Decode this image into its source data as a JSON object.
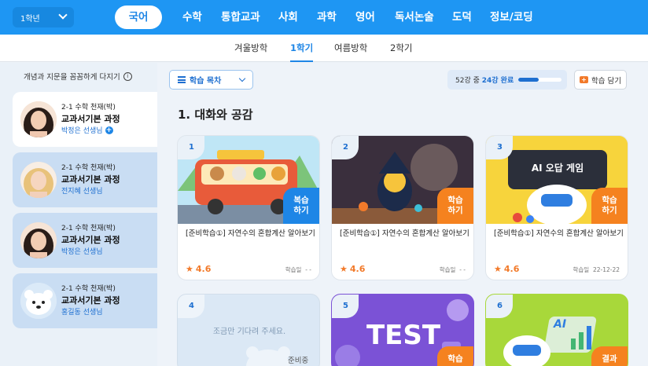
{
  "header": {
    "grade": "1학년",
    "subjects": [
      "국어",
      "수학",
      "통합교과",
      "사회",
      "과학",
      "영어",
      "독서논술",
      "도덕",
      "정보/코딩"
    ],
    "active_subject": "국어"
  },
  "semesters": [
    "겨울방학",
    "1학기",
    "여름방학",
    "2학기"
  ],
  "sidebar": {
    "hint": "개념과 지문을 꼼꼼하게 다지기",
    "teachers": [
      {
        "line1": "2-1 수학 천재(박)",
        "line2": "교과서기본 과정",
        "line3": "박정은 선생님"
      },
      {
        "line1": "2-1 수학 천재(박)",
        "line2": "교과서기본 과정",
        "line3": "전지혜 선생님"
      },
      {
        "line1": "2-1 수학 천재(박)",
        "line2": "교과서기본 과정",
        "line3": "박정은 선생님"
      },
      {
        "line1": "2-1 수학 천재(박)",
        "line2": "교과서기본 과정",
        "line3": "홍길동 선생님"
      }
    ]
  },
  "toolbar": {
    "toc_label": "학습 목차",
    "progress_prefix": "52강 중 ",
    "progress_done": "24강 완료",
    "progress_fraction": 0.46,
    "save_label": "학습 담기"
  },
  "section": {
    "title": "1. 대화와 공감"
  },
  "cards": [
    {
      "num": "1",
      "title": "[준비학습①] 자연수의 혼합계산 알아보기",
      "rating": "4.6",
      "date_label": "학습일",
      "date_value": "- -",
      "badge_l1": "복습",
      "badge_l2": "하기",
      "badge_color": "blue"
    },
    {
      "num": "2",
      "title": "[준비학습①] 자연수의 혼합계산 알아보기",
      "rating": "4.6",
      "date_label": "학습일",
      "date_value": "- -",
      "badge_l1": "학습",
      "badge_l2": "하기",
      "badge_color": "orange"
    },
    {
      "num": "3",
      "title": "[준비학습①] 자연수의 혼합계산 알아보기",
      "rating": "4.6",
      "date_label": "학습일",
      "date_value": "22-12-22",
      "badge_l1": "학습",
      "badge_l2": "하기",
      "badge_color": "orange",
      "thumb_text": "AI 오답 게임"
    },
    {
      "num": "4",
      "thumb_text": "조금만 기다려 주세요.",
      "partial_label": "준비중"
    },
    {
      "num": "5",
      "thumb_text": "TEST",
      "badge_l1": "학습"
    },
    {
      "num": "6",
      "thumb_text": "AI",
      "badge_l1": "결과"
    }
  ],
  "colors": {
    "primary": "#1e96f3",
    "accent_orange": "#f5821f",
    "accent_blue": "#1e86e6"
  }
}
